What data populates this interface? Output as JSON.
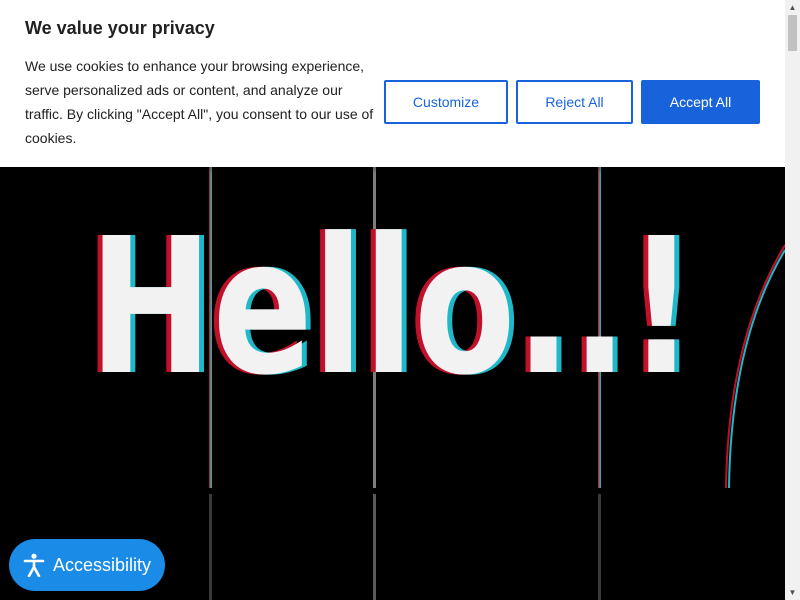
{
  "cookie_banner": {
    "title": "We value your privacy",
    "text": "We use cookies to enhance your browsing experience, serve personalized ads or content, and analyze our traffic. By clicking \"Accept All\", you consent to our use of cookies.",
    "buttons": {
      "customize": "Customize",
      "reject": "Reject All",
      "accept": "Accept All"
    }
  },
  "hero": {
    "headline": "Hello..!"
  },
  "accessibility": {
    "label": "Accessibility",
    "icon": "accessibility-person-icon"
  },
  "colors": {
    "brand_blue": "#1863dc",
    "accessibility_blue": "#1a8be6",
    "glitch_red": "#c0102a",
    "glitch_cyan": "#1fb8c8"
  }
}
